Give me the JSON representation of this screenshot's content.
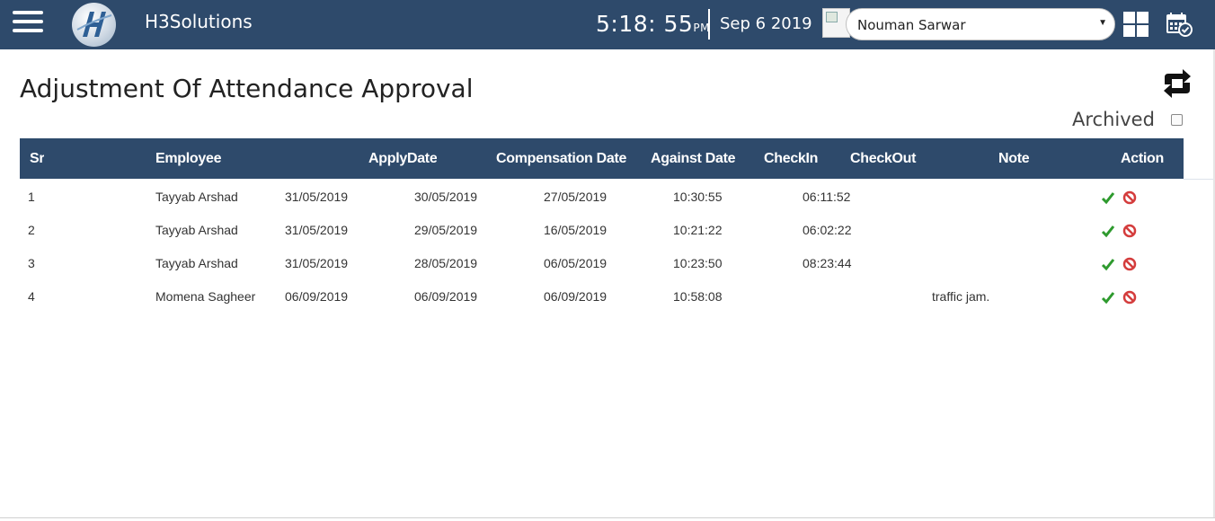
{
  "app": {
    "brand": "H3Solutions"
  },
  "header": {
    "time": "5:18: 55",
    "ampm": "PM",
    "date": "Sep 6 2019",
    "user": "Nouman Sarwar"
  },
  "page": {
    "title": "Adjustment Of Attendance Approval",
    "archived_label": "Archived"
  },
  "table": {
    "columns": {
      "sr": "Sr",
      "employee": "Employee",
      "apply": "ApplyDate",
      "comp": "Compensation Date",
      "against": "Against Date",
      "checkin": "CheckIn",
      "checkout": "CheckOut",
      "note": "Note",
      "action": "Action"
    },
    "rows": [
      {
        "sr": "1",
        "employee": "Tayyab Arshad",
        "d1": "31/05/2019",
        "d2": "30/05/2019",
        "d3": "27/05/2019",
        "t1": "10:30:55",
        "t2": "06:11:52",
        "note": ""
      },
      {
        "sr": "2",
        "employee": "Tayyab Arshad",
        "d1": "31/05/2019",
        "d2": "29/05/2019",
        "d3": "16/05/2019",
        "t1": "10:21:22",
        "t2": "06:02:22",
        "note": ""
      },
      {
        "sr": "3",
        "employee": "Tayyab Arshad",
        "d1": "31/05/2019",
        "d2": "28/05/2019",
        "d3": "06/05/2019",
        "t1": "10:23:50",
        "t2": "08:23:44",
        "note": ""
      },
      {
        "sr": "4",
        "employee": "Momena Sagheer",
        "d1": "06/09/2019",
        "d2": "06/09/2019",
        "d3": "06/09/2019",
        "t1": "10:58:08",
        "t2": "",
        "note": "traffic jam."
      }
    ]
  },
  "icons": {
    "menu": "hamburger-icon",
    "approve": "check-icon",
    "reject": "ban-icon",
    "refresh": "refresh-arrows-icon",
    "apps": "grid-icon",
    "calendar": "calendar-check-icon"
  },
  "colors": {
    "header_bg": "#2e4a6b",
    "approve": "#2e9a2e",
    "reject": "#d43c3c"
  }
}
